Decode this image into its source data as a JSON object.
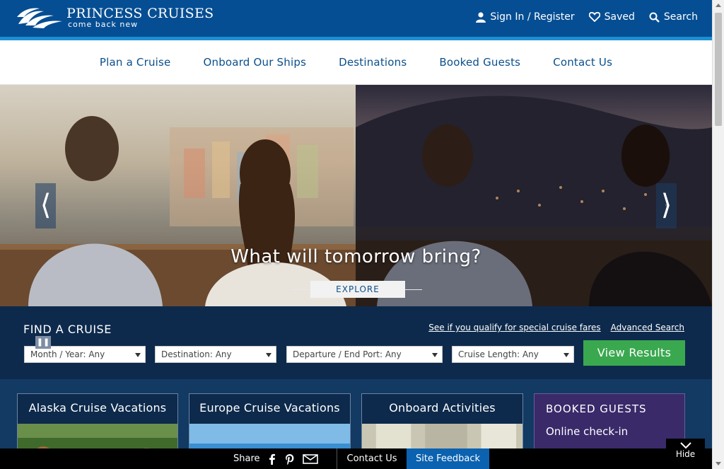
{
  "brand": {
    "name": "PRINCESS CRUISES",
    "tagline": "come back new",
    "colors": {
      "primary": "#064e93",
      "accent": "#1d8fd4",
      "cta": "#3aa84f",
      "dark": "#0d2a4c"
    }
  },
  "top_links": [
    {
      "icon": "user-icon",
      "label": "Sign In / Register"
    },
    {
      "icon": "heart-icon",
      "label": "Saved"
    },
    {
      "icon": "search-icon",
      "label": "Search"
    }
  ],
  "nav": [
    "Plan a Cruise",
    "Onboard Our Ships",
    "Destinations",
    "Booked Guests",
    "Contact Us"
  ],
  "hero": {
    "caption": "What will tomorrow bring?",
    "button": "EXPLORE",
    "prev_icon": "chevron-left-icon",
    "next_icon": "chevron-right-icon",
    "pause_icon": "pause-icon"
  },
  "finder": {
    "title": "FIND A CRUISE",
    "links": [
      "See if you qualify for special cruise fares",
      "Advanced Search"
    ],
    "selects": [
      "Month / Year: Any",
      "Destination: Any",
      "Departure / End Port: Any",
      "Cruise Length: Any"
    ],
    "submit": "View Results"
  },
  "cards": [
    {
      "title": "Alaska Cruise Vacations"
    },
    {
      "title": "Europe Cruise Vacations"
    },
    {
      "title": "Onboard Activities"
    }
  ],
  "booked_card": {
    "title": "BOOKED GUESTS",
    "subtitle": "Online check-in"
  },
  "bottom_bar": {
    "share": "Share",
    "share_icons": [
      "facebook-icon",
      "pinterest-icon",
      "email-icon"
    ],
    "contact": "Contact Us",
    "feedback": "Site Feedback",
    "hide": "Hide"
  }
}
